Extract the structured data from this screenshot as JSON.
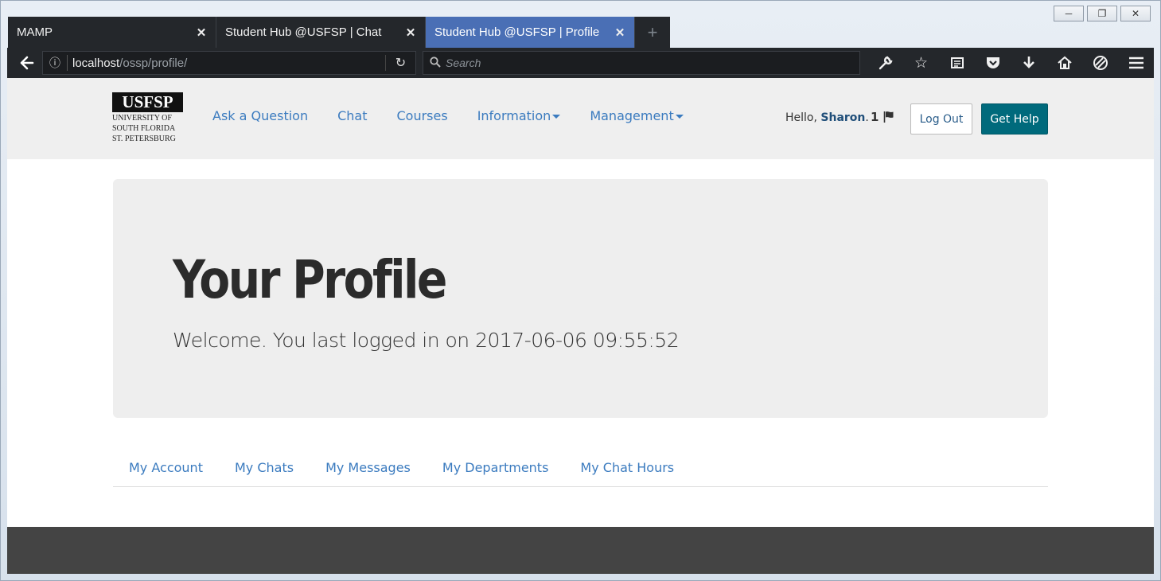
{
  "window": {
    "controls": [
      "minimize",
      "maximize",
      "close"
    ]
  },
  "tabs": [
    {
      "title": "MAMP",
      "active": false
    },
    {
      "title": "Student Hub @USFSP | Chat",
      "active": false
    },
    {
      "title": "Student Hub @USFSP | Profile",
      "active": true
    }
  ],
  "address_bar": {
    "host": "localhost",
    "path": "/ossp/profile/"
  },
  "search_bar": {
    "placeholder": "Search"
  },
  "toolbar_icons": [
    "wrench-icon",
    "star-icon",
    "reader-icon",
    "pocket-icon",
    "download-icon",
    "home-icon",
    "sync-icon",
    "menu-icon"
  ],
  "site": {
    "logo": {
      "mark": "USFSP",
      "line1": "UNIVERSITY OF",
      "line2": "SOUTH FLORIDA",
      "line3": "ST. PETERSBURG"
    },
    "nav": {
      "ask": "Ask a Question",
      "chat": "Chat",
      "courses": "Courses",
      "information": "Information",
      "management": "Management"
    },
    "user": {
      "hello_prefix": "Hello, ",
      "name": "Sharon",
      "hello_suffix": ".",
      "flag_count": "1"
    },
    "buttons": {
      "logout": "Log Out",
      "help": "Get Help"
    }
  },
  "profile": {
    "title": "Your Profile",
    "welcome": "Welcome. You last logged in on 2017-06-06 09:55:52"
  },
  "profile_tabs": [
    "My Account",
    "My Chats",
    "My Messages",
    "My Departments",
    "My Chat Hours"
  ],
  "colors": {
    "link": "#3b7bbf",
    "help_button": "#006a7c",
    "active_tab": "#4a6fb5",
    "footer": "#444444"
  }
}
